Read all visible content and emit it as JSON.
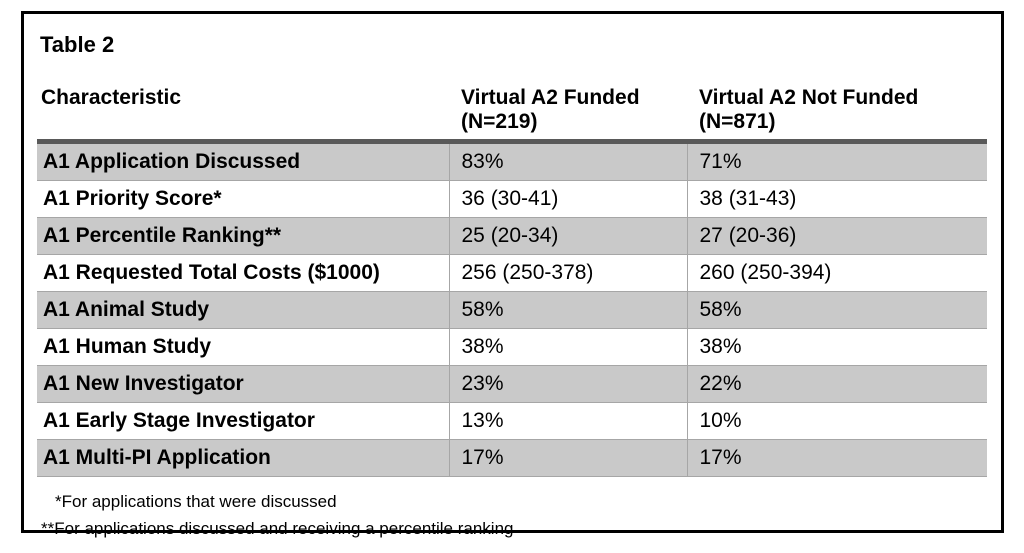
{
  "table": {
    "caption": "Table 2",
    "columns": [
      {
        "key": "characteristic",
        "label": "Characteristic",
        "sublabel": ""
      },
      {
        "key": "funded",
        "label": "Virtual A2 Funded",
        "sublabel": "(N=219)"
      },
      {
        "key": "not_funded",
        "label": "Virtual A2 Not Funded",
        "sublabel": "(N=871)"
      }
    ],
    "rows": [
      {
        "characteristic": "A1 Application Discussed",
        "funded": "83%",
        "not_funded": "71%",
        "shaded": true
      },
      {
        "characteristic": "A1 Priority Score*",
        "funded": "36 (30-41)",
        "not_funded": "38 (31-43)",
        "shaded": false
      },
      {
        "characteristic": "A1 Percentile Ranking**",
        "funded": "25 (20-34)",
        "not_funded": "27 (20-36)",
        "shaded": true
      },
      {
        "characteristic": "A1 Requested Total Costs ($1000)",
        "funded": "256 (250-378)",
        "not_funded": "260 (250-394)",
        "shaded": false
      },
      {
        "characteristic": "A1 Animal Study",
        "funded": "58%",
        "not_funded": "58%",
        "shaded": true
      },
      {
        "characteristic": "A1 Human Study",
        "funded": "38%",
        "not_funded": "38%",
        "shaded": false
      },
      {
        "characteristic": "A1 New Investigator",
        "funded": "23%",
        "not_funded": "22%",
        "shaded": true
      },
      {
        "characteristic": "A1 Early Stage Investigator",
        "funded": "13%",
        "not_funded": "10%",
        "shaded": false
      },
      {
        "characteristic": "A1 Multi-PI Application",
        "funded": "17%",
        "not_funded": "17%",
        "shaded": true
      }
    ],
    "footnotes": [
      {
        "marker_class": "footnote-single",
        "text": "*For applications that were discussed"
      },
      {
        "marker_class": "footnote-double",
        "text": "**For applications discussed and receiving a percentile ranking"
      }
    ]
  },
  "colors": {
    "frame_border": "#000000",
    "row_shade": "#c9c9c9",
    "row_plain": "#ffffff",
    "header_rule": "#595959",
    "cell_rule": "#a6a6a6",
    "text": "#000000"
  }
}
